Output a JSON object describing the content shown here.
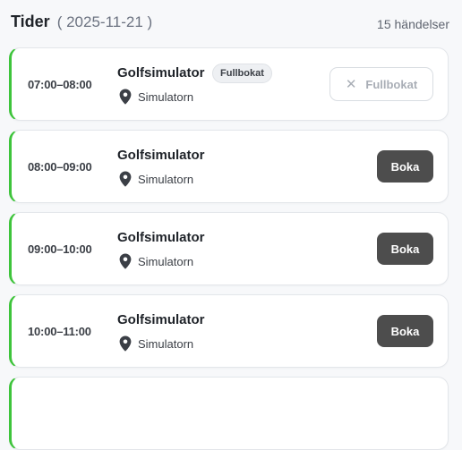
{
  "header": {
    "title": "Tider",
    "date": "( 2025-11-21 )",
    "count": "15 händelser"
  },
  "colors": {
    "accent": "#3ec43b",
    "button": "#4d4d4d"
  },
  "slots": [
    {
      "time": "07:00–08:00",
      "name": "Golfsimulator",
      "badge": "Fullbokat",
      "location": "Simulatorn",
      "action": "Fullbokat",
      "icon": "close-icon"
    },
    {
      "time": "08:00–09:00",
      "name": "Golfsimulator",
      "location": "Simulatorn",
      "action": "Boka"
    },
    {
      "time": "09:00–10:00",
      "name": "Golfsimulator",
      "location": "Simulatorn",
      "action": "Boka"
    },
    {
      "time": "10:00–11:00",
      "name": "Golfsimulator",
      "location": "Simulatorn",
      "action": "Boka"
    }
  ]
}
